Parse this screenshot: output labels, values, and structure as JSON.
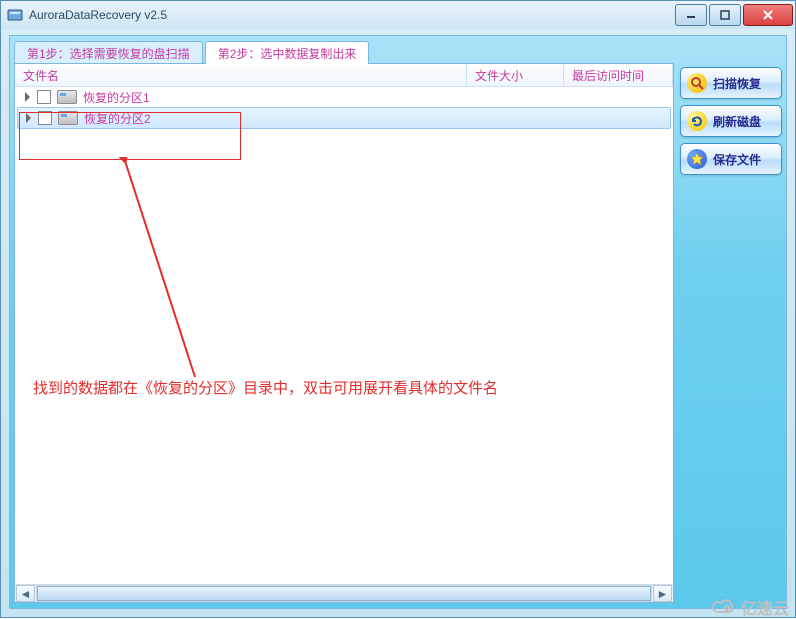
{
  "window": {
    "title": "AuroraDataRecovery v2.5"
  },
  "tabs": {
    "step1": "第1步：选择需要恢复的盘扫描",
    "step2": "第2步：选中数据复制出来"
  },
  "columns": {
    "name": "文件名",
    "size": "文件大小",
    "time": "最后访问时间"
  },
  "rows": [
    {
      "label": "恢复的分区1",
      "selected": false
    },
    {
      "label": "恢复的分区2",
      "selected": true
    }
  ],
  "side": {
    "scan": "扫描恢复",
    "refresh": "刷新磁盘",
    "save": "保存文件"
  },
  "annotation": {
    "text": "找到的数据都在《恢复的分区》目录中，双击可用展开看具体的文件名"
  },
  "watermark": "亿速云"
}
